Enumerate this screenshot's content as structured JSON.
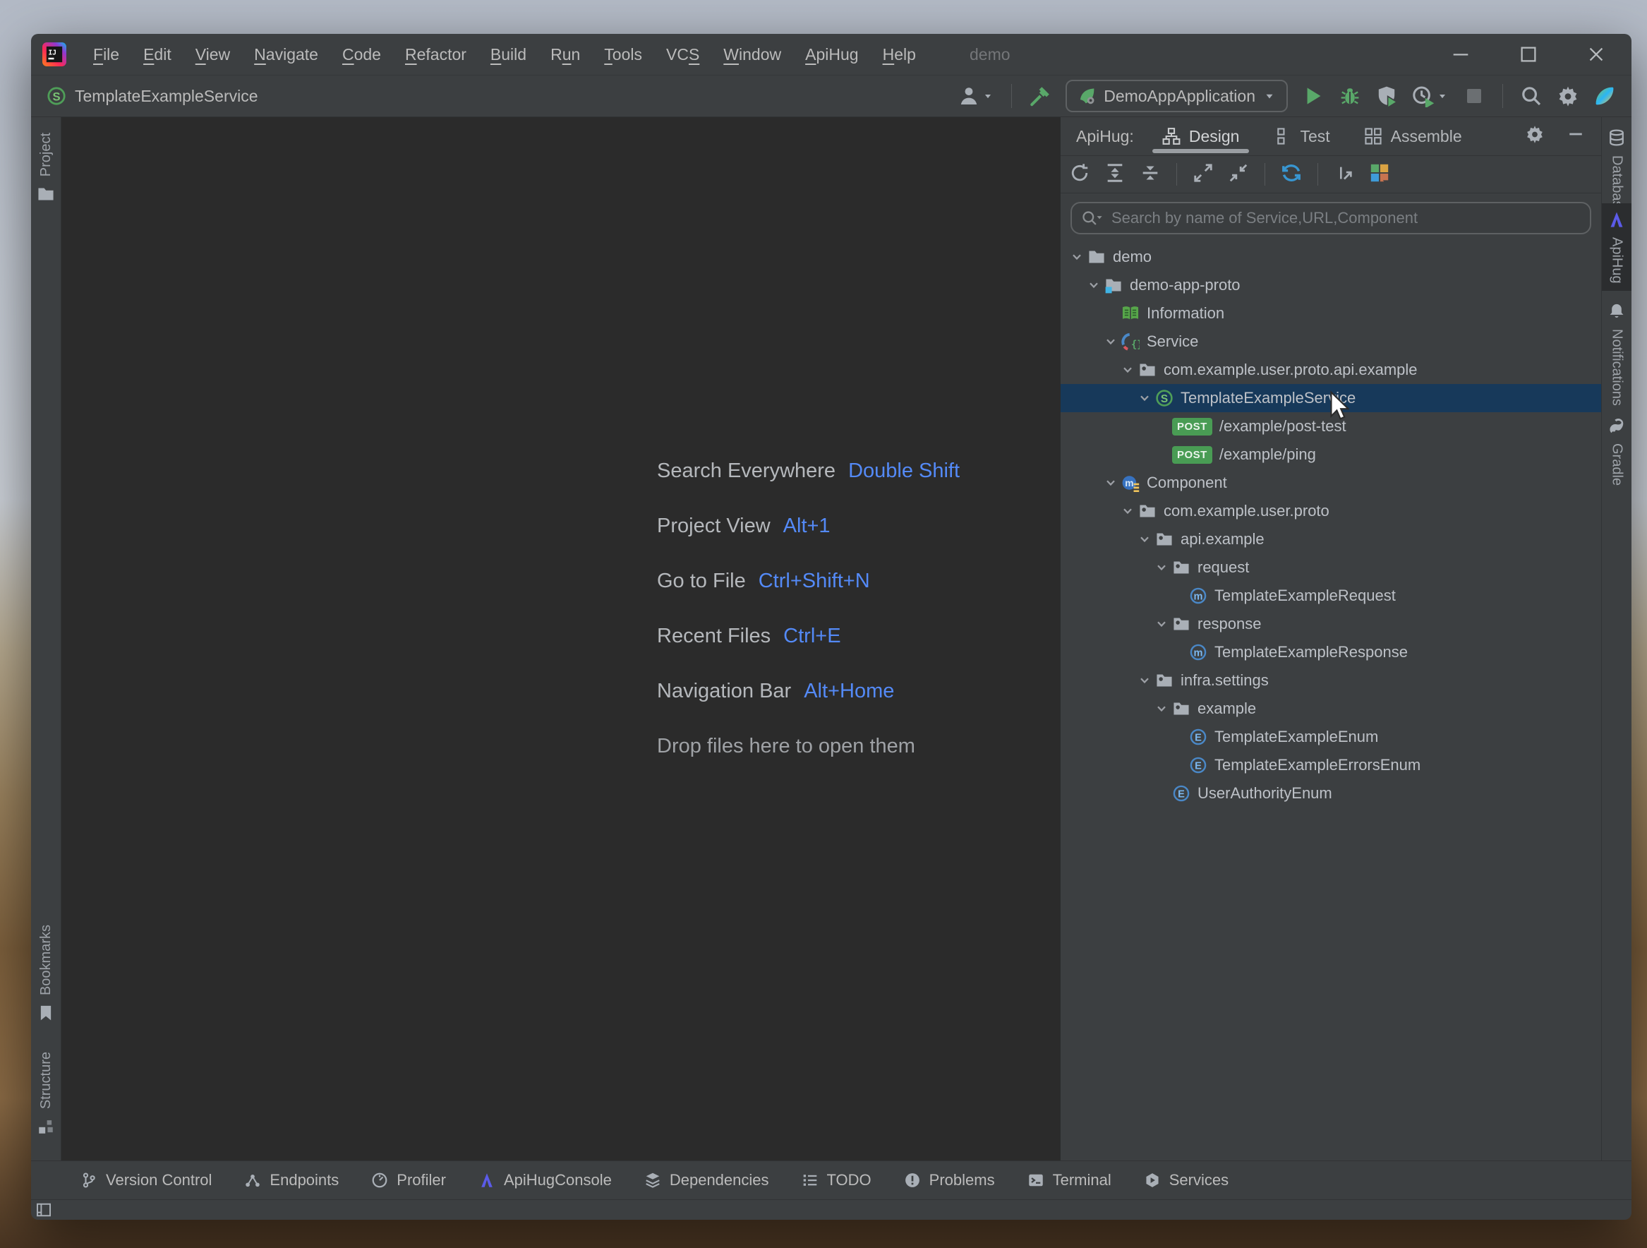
{
  "window": {
    "title": "demo",
    "controls": [
      {
        "name": "minimize",
        "icon": "win-min"
      },
      {
        "name": "maximize",
        "icon": "win-max"
      },
      {
        "name": "close",
        "icon": "win-close"
      }
    ]
  },
  "menu_bar": {
    "items": [
      {
        "label": "File",
        "mnemonic": 0
      },
      {
        "label": "Edit",
        "mnemonic": 0
      },
      {
        "label": "View",
        "mnemonic": 0
      },
      {
        "label": "Navigate",
        "mnemonic": 0
      },
      {
        "label": "Code",
        "mnemonic": 0
      },
      {
        "label": "Refactor",
        "mnemonic": 0
      },
      {
        "label": "Build",
        "mnemonic": 0
      },
      {
        "label": "Run",
        "mnemonic": 1
      },
      {
        "label": "Tools",
        "mnemonic": 0
      },
      {
        "label": "VCS",
        "mnemonic": 2
      },
      {
        "label": "Window",
        "mnemonic": 0
      },
      {
        "label": "ApiHug",
        "mnemonic": 0
      },
      {
        "label": "Help",
        "mnemonic": 0
      }
    ]
  },
  "header_toolbar": {
    "breadcrumb": {
      "icon": "s-circle",
      "label": "TemplateExampleService"
    },
    "run_config": {
      "label": "DemoAppApplication",
      "icon": "run-leaf"
    },
    "items": [
      {
        "type": "icon",
        "icon": "user",
        "name": "user-profile-button",
        "caret": true
      },
      {
        "type": "sep"
      },
      {
        "type": "icon",
        "icon": "hammer",
        "name": "build-project-button"
      },
      {
        "type": "combo"
      },
      {
        "type": "icon",
        "icon": "play",
        "name": "run-button"
      },
      {
        "type": "icon",
        "icon": "debug",
        "name": "debug-button"
      },
      {
        "type": "icon",
        "icon": "coverage",
        "name": "run-with-coverage-button"
      },
      {
        "type": "icon",
        "icon": "profiler-run",
        "name": "profiler-button",
        "caret": true
      },
      {
        "type": "icon",
        "icon": "stop",
        "name": "stop-button"
      },
      {
        "type": "sep"
      },
      {
        "type": "icon",
        "icon": "search",
        "name": "search-everywhere-button"
      },
      {
        "type": "icon",
        "icon": "gear",
        "name": "settings-button"
      },
      {
        "type": "icon",
        "icon": "ai",
        "name": "ai-assistant-button"
      }
    ]
  },
  "editor": {
    "shortcuts": [
      {
        "label": "Search Everywhere",
        "keys": "Double Shift"
      },
      {
        "label": "Project View",
        "keys": "Alt+1"
      },
      {
        "label": "Go to File",
        "keys": "Ctrl+Shift+N"
      },
      {
        "label": "Recent Files",
        "keys": "Ctrl+E"
      },
      {
        "label": "Navigation Bar",
        "keys": "Alt+Home"
      }
    ],
    "drop_hint": "Drop files here to open them"
  },
  "left_stripe": {
    "tabs": [
      {
        "label": "Project",
        "icon": "folder-tab"
      },
      {
        "label": "Bookmarks",
        "icon": "bookmark"
      },
      {
        "label": "Structure",
        "icon": "structure"
      }
    ]
  },
  "right_stripe": {
    "tabs": [
      {
        "label": "Database",
        "icon": "database"
      },
      {
        "label": "ApiHug",
        "icon": "apihug-a",
        "selected": true
      },
      {
        "label": "Notifications",
        "icon": "bell"
      },
      {
        "label": "Gradle",
        "icon": "gradle"
      }
    ]
  },
  "apihug_panel": {
    "title": "ApiHug:",
    "tabs": [
      {
        "label": "Design",
        "icon": "design",
        "selected": true
      },
      {
        "label": "Test",
        "icon": "test"
      },
      {
        "label": "Assemble",
        "icon": "assemble"
      }
    ],
    "actions": [
      {
        "icon": "gear",
        "name": "panel-settings-button"
      },
      {
        "icon": "minus",
        "name": "panel-hide-button"
      }
    ],
    "toolbar": [
      "refresh",
      "expand-all",
      "collapse-all",
      "sep",
      "maximize-diag",
      "minimize-diag",
      "sep",
      "sync",
      "sep",
      "open-external",
      "color-grid"
    ],
    "search": {
      "placeholder": "Search by name of Service,URL,Component"
    },
    "method_badge": "POST",
    "tree": [
      {
        "label": "demo",
        "icon": "folder",
        "level": 0,
        "chevron": true
      },
      {
        "label": "demo-app-proto",
        "icon": "folder-badge",
        "level": 1,
        "chevron": true
      },
      {
        "label": "Information",
        "icon": "book",
        "level": 2,
        "chevron": false
      },
      {
        "label": "Service",
        "icon": "service",
        "level": 2,
        "chevron": true
      },
      {
        "label": "com.example.user.proto.api.example",
        "icon": "package",
        "level": 3,
        "chevron": true
      },
      {
        "label": "TemplateExampleService",
        "icon": "s-circle",
        "level": 4,
        "chevron": true,
        "selected": true
      },
      {
        "label": "/example/post-test",
        "icon": "post",
        "level": 5,
        "chevron": false
      },
      {
        "label": "/example/ping",
        "icon": "post",
        "level": 5,
        "chevron": false
      },
      {
        "label": "Component",
        "icon": "component",
        "level": 2,
        "chevron": true
      },
      {
        "label": "com.example.user.proto",
        "icon": "package",
        "level": 3,
        "chevron": true
      },
      {
        "label": "api.example",
        "icon": "package",
        "level": 4,
        "chevron": true
      },
      {
        "label": "request",
        "icon": "package",
        "level": 5,
        "chevron": true
      },
      {
        "label": "TemplateExampleRequest",
        "icon": "m-circle",
        "level": 6,
        "chevron": false
      },
      {
        "label": "response",
        "icon": "package",
        "level": 5,
        "chevron": true
      },
      {
        "label": "TemplateExampleResponse",
        "icon": "m-circle",
        "level": 6,
        "chevron": false
      },
      {
        "label": "infra.settings",
        "icon": "package",
        "level": 4,
        "chevron": true
      },
      {
        "label": "example",
        "icon": "package",
        "level": 5,
        "chevron": true
      },
      {
        "label": "TemplateExampleEnum",
        "icon": "e-circle",
        "level": 6,
        "chevron": false
      },
      {
        "label": "TemplateExampleErrorsEnum",
        "icon": "e-circle",
        "level": 6,
        "chevron": false
      },
      {
        "label": "UserAuthorityEnum",
        "icon": "e-circle",
        "level": 5,
        "chevron": false
      }
    ]
  },
  "bottom_bar": {
    "items": [
      {
        "label": "Version Control",
        "icon": "branch"
      },
      {
        "label": "Endpoints",
        "icon": "endpoints"
      },
      {
        "label": "Profiler",
        "icon": "profiler"
      },
      {
        "label": "ApiHugConsole",
        "icon": "apihug-a"
      },
      {
        "label": "Dependencies",
        "icon": "dependencies"
      },
      {
        "label": "TODO",
        "icon": "todo"
      },
      {
        "label": "Problems",
        "icon": "problems"
      },
      {
        "label": "Terminal",
        "icon": "terminal"
      },
      {
        "label": "Services",
        "icon": "services"
      }
    ]
  },
  "colors": {
    "panel_bg": "#3C3F41",
    "editor_bg": "#2B2B2B",
    "selection": "#17395A",
    "accent_blue": "#548AF7",
    "post_green": "#499C54",
    "apihug_purple": "#5B5BE8"
  }
}
